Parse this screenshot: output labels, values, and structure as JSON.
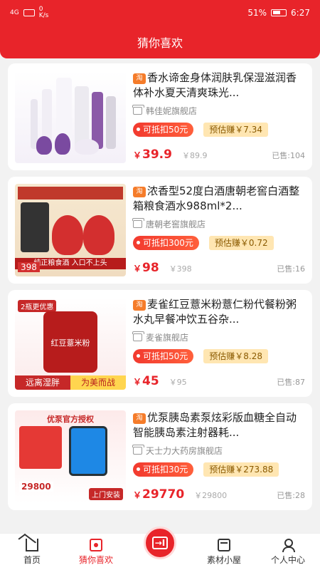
{
  "status_bar": {
    "signal_label": "4G",
    "speed": "0\nK/s",
    "battery": "51%",
    "time": "6:27"
  },
  "header": {
    "title": "猜你喜欢"
  },
  "products": [
    {
      "tag": "淘",
      "name": "香水谛金身体润肤乳保湿滋润香体补水夏天清爽珠光...",
      "shop": "韩佳妮旗舰店",
      "coupon": "可抵扣50元",
      "earn": "预估赚￥7.34",
      "price_symbol": "￥",
      "price": "39.9",
      "old_price": "￥89.9",
      "sold": "已售:104"
    },
    {
      "tag": "淘",
      "name": "浓香型52度白酒唐朝老窖白酒整箱粮食酒水988ml*2...",
      "shop": "唐朝老窖旗舰店",
      "coupon": "可抵扣300元",
      "earn": "预估赚￥0.72",
      "price_symbol": "￥",
      "price": "98",
      "old_price": "￥398",
      "sold": "已售:16",
      "thumb_text": "纯正粮食酒 入口不上头",
      "thumb_price": "398"
    },
    {
      "tag": "淘",
      "name": "麦雀红豆薏米粉薏仁粉代餐粉粥水丸早餐冲饮五谷杂...",
      "shop": "麦雀旗舰店",
      "coupon": "可抵扣50元",
      "earn": "预估赚￥8.28",
      "price_symbol": "￥",
      "price": "45",
      "old_price": "￥95",
      "sold": "已售:87",
      "thumb_top": "2瓶更优惠",
      "thumb_mid": "红豆薏米粉",
      "thumb_bottom_left": "远离湿胖",
      "thumb_bottom_right": "为美而战"
    },
    {
      "tag": "淘",
      "name": "优泵胰岛素泵炫彩版血糖全自动智能胰岛素注射器耗...",
      "shop": "天士力大药房旗舰店",
      "coupon": "可抵扣30元",
      "earn": "预估赚￥273.88",
      "price_symbol": "￥",
      "price": "29770",
      "old_price": "￥29800",
      "sold": "已售:28",
      "thumb_top": "优泵官方授权",
      "thumb_price": "29800",
      "thumb_bottom": "上门安装"
    }
  ],
  "bottom_nav": {
    "home": "首页",
    "guess": "猜你喜欢",
    "center": "→I",
    "material": "素材小屋",
    "profile": "个人中心"
  },
  "colors": {
    "brand": "#e8242a",
    "earn_bg": "#ffe6b2",
    "tag": "#f57c2a"
  }
}
